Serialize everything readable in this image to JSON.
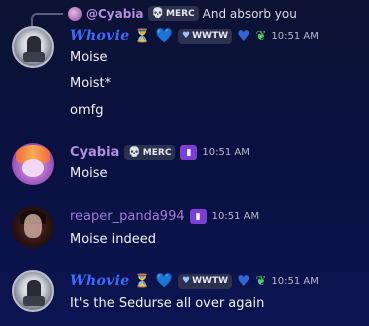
{
  "reply": {
    "username": "@Cyabia",
    "tag": "MERC",
    "text": "And absorb you"
  },
  "messages": [
    {
      "author": "Whovie",
      "tag": "WWTW",
      "timestamp": "10:51 AM",
      "lines": [
        "Moise",
        "Moist*",
        "omfg"
      ]
    },
    {
      "author": "Cyabia",
      "tag": "MERC",
      "timestamp": "10:51 AM",
      "lines": [
        "Moise"
      ]
    },
    {
      "author": "reaper_panda994",
      "timestamp": "10:51 AM",
      "lines": [
        "Moise indeed"
      ]
    },
    {
      "author": "Whovie",
      "tag": "WWTW",
      "timestamp": "10:51 AM",
      "lines": [
        "It's the Sedurse all over again"
      ]
    }
  ],
  "icons": {
    "hourglass": "hourglass-icon",
    "heart": "heart-icon",
    "leaf": "leaf-icon",
    "skull": "skull-icon",
    "twitch": "twitch-icon"
  },
  "colors": {
    "whovie_name": "#3d6bff",
    "cyabia_name": "#b48ee0",
    "reaper_name": "#a67ad6",
    "background": "#0b1233"
  }
}
